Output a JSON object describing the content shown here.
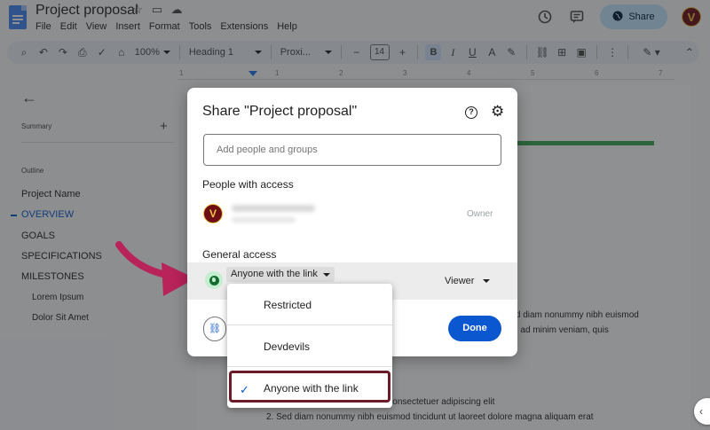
{
  "header": {
    "title": "Project proposal",
    "menu": [
      "File",
      "Edit",
      "View",
      "Insert",
      "Format",
      "Tools",
      "Extensions",
      "Help"
    ],
    "share_label": "Share",
    "avatar_letter": "V"
  },
  "toolbar": {
    "zoom": "100%",
    "style": "Heading 1",
    "font": "Proxi...",
    "font_size": "14",
    "bold": "B"
  },
  "ruler": {
    "marks": [
      "1",
      "1",
      "2",
      "3",
      "4",
      "5",
      "6",
      "7"
    ]
  },
  "sidebar": {
    "summary": "Summary",
    "outline": "Outline",
    "items": [
      "Project Name",
      "OVERVIEW",
      "GOALS",
      "SPECIFICATIONS",
      "MILESTONES"
    ],
    "sub_items": [
      "Lorem Ipsum",
      "Dolor Sit Amet"
    ],
    "active": "OVERVIEW"
  },
  "document": {
    "lines": [
      "r sit amet, consectetuer adipiscing elit, sed diam nonummy nibh euismod",
      "magna aliquam erat volutpat. Ut wisi enim ad minim veniam, quis",
      "1.   Lorem ipsum dolor sit amet, consectetuer adipiscing elit",
      "2.   Sed diam nonummy nibh euismod tincidunt ut laoreet dolore magna aliquam erat"
    ]
  },
  "dialog": {
    "title": "Share \"Project proposal\"",
    "add_placeholder": "Add people and groups",
    "people_label": "People with access",
    "person_role": "Owner",
    "person_avatar_letter": "V",
    "general_access_label": "General access",
    "access_value": "Anyone with the link",
    "role_value": "Viewer",
    "done_label": "Done"
  },
  "dropdown": {
    "options": [
      "Restricted",
      "Devdevils",
      "Anyone with the link"
    ],
    "selected": "Anyone with the link"
  },
  "colors": {
    "accent": "#0b57d0",
    "share_button": "#c2e7ff",
    "highlight_border": "#6b1a28",
    "arrow": "#b8235a",
    "green_bar": "#34a853"
  }
}
